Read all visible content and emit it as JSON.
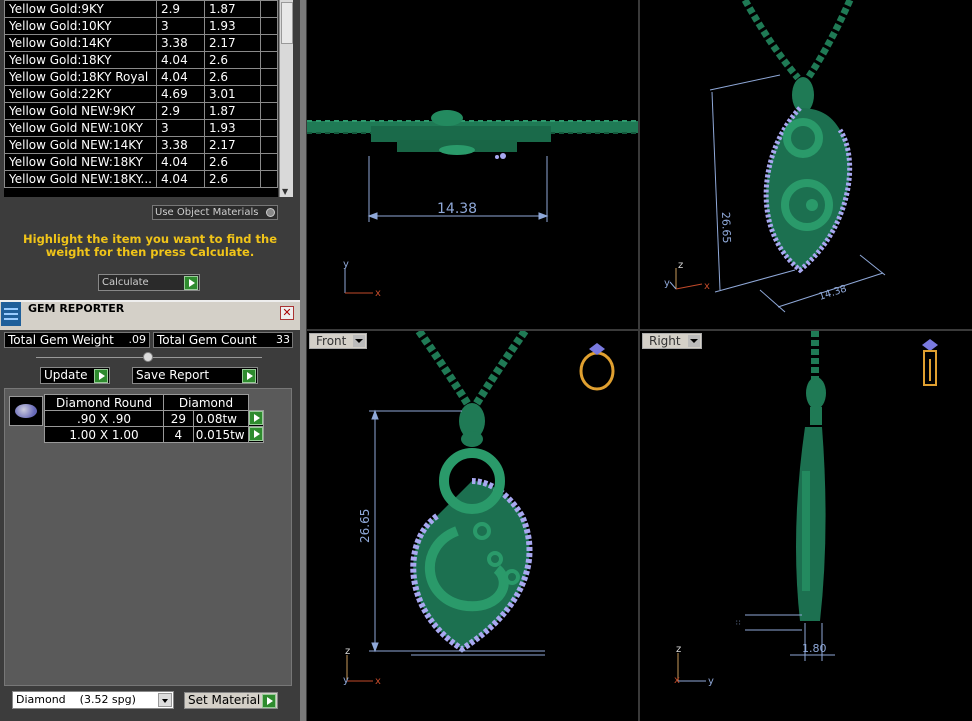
{
  "materials": {
    "rows": [
      [
        "Yellow Gold:9KY",
        "2.9",
        "1.87"
      ],
      [
        "Yellow Gold:10KY",
        "3",
        "1.93"
      ],
      [
        "Yellow Gold:14KY",
        "3.38",
        "2.17"
      ],
      [
        "Yellow Gold:18KY",
        "4.04",
        "2.6"
      ],
      [
        "Yellow Gold:18KY Royal",
        "4.04",
        "2.6"
      ],
      [
        "Yellow Gold:22KY",
        "4.69",
        "3.01"
      ],
      [
        "Yellow Gold NEW:9KY",
        "2.9",
        "1.87"
      ],
      [
        "Yellow Gold NEW:10KY",
        "3",
        "1.93"
      ],
      [
        "Yellow Gold NEW:14KY",
        "3.38",
        "2.17"
      ],
      [
        "Yellow Gold NEW:18KY",
        "4.04",
        "2.6"
      ],
      [
        "Yellow Gold NEW:18KY...",
        "4.04",
        "2.6"
      ]
    ],
    "use_object_materials_label": "Use Object Materials",
    "hint": "Highlight the item you want to find the weight for then press Calculate.",
    "calculate_label": "Calculate"
  },
  "gem_reporter": {
    "title": "GEM REPORTER",
    "total_weight_label": "Total Gem Weight",
    "total_weight_value": ".09",
    "total_count_label": "Total Gem Count",
    "total_count_value": "33",
    "update_label": "Update",
    "save_report_label": "Save Report",
    "table": {
      "header_cut": "Diamond Round",
      "header_material": "Diamond",
      "rows": [
        {
          "size": ".90 X .90",
          "count": "29",
          "weight": "0.08tw"
        },
        {
          "size": "1.00 X 1.00",
          "count": "4",
          "weight": "0.015tw"
        }
      ]
    },
    "material_select": "Diamond    (3.52 spg)",
    "set_material_label": "Set Material"
  },
  "viewports": {
    "top_dim": "14.38",
    "persp_dim_height": "26.65",
    "persp_dim_width": "14.38",
    "front_label": "Front",
    "front_dim": "26.65",
    "right_label": "Right",
    "right_dim": "1.80",
    "axis_x": "x",
    "axis_y": "y",
    "axis_z": "z"
  },
  "colors": {
    "model_green": "#1f7a55",
    "gem_lavender": "#a8a8f0",
    "dim_line": "#8fa8d8",
    "hint_yellow": "#f0c419"
  }
}
